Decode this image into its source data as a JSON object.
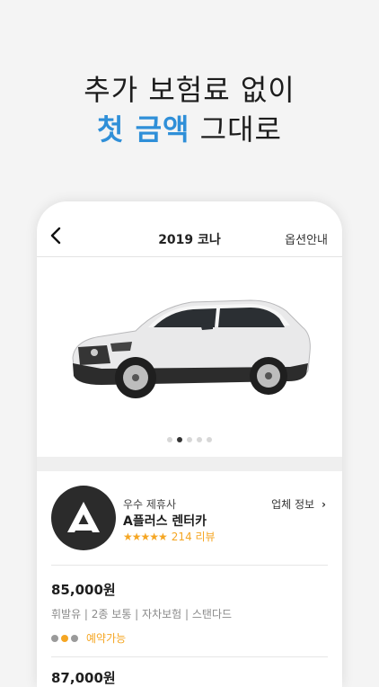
{
  "headline": {
    "line1": "추가 보험료 없이",
    "accent": "첫 금액",
    "rest": "그대로"
  },
  "nav": {
    "title": "2019 코나",
    "option": "옵션안내",
    "back_icon": "chevron-left-icon"
  },
  "carousel": {
    "total": 5,
    "active_index": 1
  },
  "partner": {
    "badge": "우수 제휴사",
    "name": "A플러스 렌터카",
    "stars": "★★★★★",
    "reviews": "214 리뷰",
    "info_label": "업체 정보",
    "info_chevron": "›",
    "logo_letter": "A"
  },
  "offers": [
    {
      "price": "85,000원",
      "specs": "휘발유 | 2종 보통 | 자차보험 | 스탠다드",
      "status": "예약가능"
    },
    {
      "price": "87,000원"
    }
  ],
  "colors": {
    "accent": "#2f8fd8",
    "star": "#f5a623"
  }
}
